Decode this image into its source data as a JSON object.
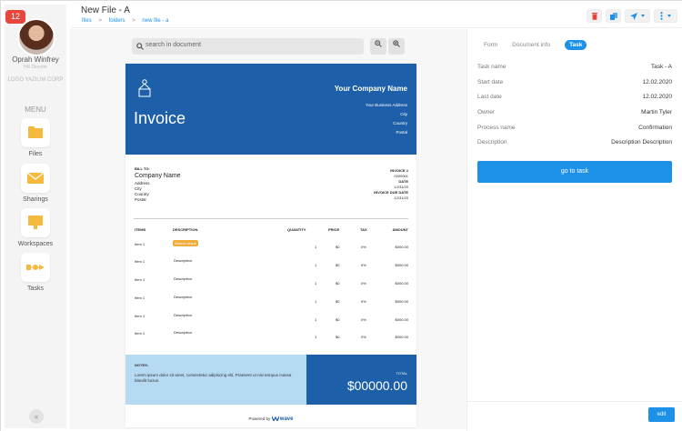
{
  "sidebar": {
    "notification_count": "12",
    "user_name": "Oprah Winfrey",
    "user_role": "HR Director",
    "company": "LOGO YAZILIM CORP",
    "menu_label": "MENU",
    "items": [
      {
        "label": "Files",
        "icon": "folder-icon"
      },
      {
        "label": "Sharings",
        "icon": "envelope-icon"
      },
      {
        "label": "Workspaces",
        "icon": "workspace-icon"
      },
      {
        "label": "Tasks",
        "icon": "flow-icon"
      }
    ],
    "collapse_glyph": "«"
  },
  "header": {
    "title": "New File - A",
    "breadcrumb": [
      "files",
      "folders",
      "new file - a"
    ],
    "breadcrumb_sep": ">",
    "buttons": [
      "trash-icon",
      "share-icon",
      "send-icon",
      "more-icon"
    ],
    "colors": {
      "trash": "#e8463d",
      "accent": "#1d91e8"
    }
  },
  "document": {
    "search_placeholder": "search in document",
    "invoice": {
      "company_name": "Your Company Name",
      "company_lines": [
        "Your Business Address",
        "City",
        "Country",
        "Postal"
      ],
      "title": "Invoice",
      "bill_to_label": "BILL TO:",
      "bill_company": "Company Name",
      "bill_lines": [
        "Address",
        "City",
        "Country",
        "Postal"
      ],
      "invoice_no_label": "INVOICE #",
      "invoice_no": "0000001",
      "date_label": "DATE",
      "date": "12/31/20",
      "due_label": "INVOICE DUE DATE",
      "due": "12/31/20",
      "columns": [
        "ITEMS",
        "DESCRIPTION",
        "QUANTITY",
        "PRICE",
        "TAX",
        "AMOUNT"
      ],
      "rows": [
        {
          "item": "Item 1",
          "desc": "Search result",
          "qty": "1",
          "price": "$0",
          "tax": "0%",
          "amount": "$000.00"
        },
        {
          "item": "Item 1",
          "desc": "Description",
          "qty": "1",
          "price": "$0",
          "tax": "0%",
          "amount": "$000.00"
        },
        {
          "item": "Item 1",
          "desc": "Description",
          "qty": "1",
          "price": "$0",
          "tax": "0%",
          "amount": "$000.00"
        },
        {
          "item": "Item 1",
          "desc": "Description",
          "qty": "1",
          "price": "$0",
          "tax": "0%",
          "amount": "$000.00"
        },
        {
          "item": "Item 1",
          "desc": "Description",
          "qty": "1",
          "price": "$0",
          "tax": "0%",
          "amount": "$000.00"
        },
        {
          "item": "Item 1",
          "desc": "Description",
          "qty": "1",
          "price": "$0",
          "tax": "0%",
          "amount": "$000.00"
        }
      ],
      "notes_label": "NOTES:",
      "notes_text": "Lorem ipsum dolor sit amet, consectetur adipiscing elit. Praesent ut nisi tempus massa blandit luctus.",
      "total_label": "TOTAL",
      "total_value": "$00000.00",
      "powered_by": "Powered by",
      "powered_brand": "wave"
    }
  },
  "panel": {
    "tabs": [
      "Form",
      "Document info",
      "Task"
    ],
    "active_tab": "Task",
    "fields": [
      {
        "label": "Task name",
        "value": "Task - A"
      },
      {
        "label": "Start date",
        "value": "12.02.2020"
      },
      {
        "label": "Last date",
        "value": "12.02.2020"
      },
      {
        "label": "Owner",
        "value": "Martin Tyler"
      },
      {
        "label": "Process name",
        "value": "Confirmation"
      },
      {
        "label": "Description",
        "value": "Description Description"
      }
    ],
    "go_button": "go to task",
    "edit_button": "edit"
  }
}
